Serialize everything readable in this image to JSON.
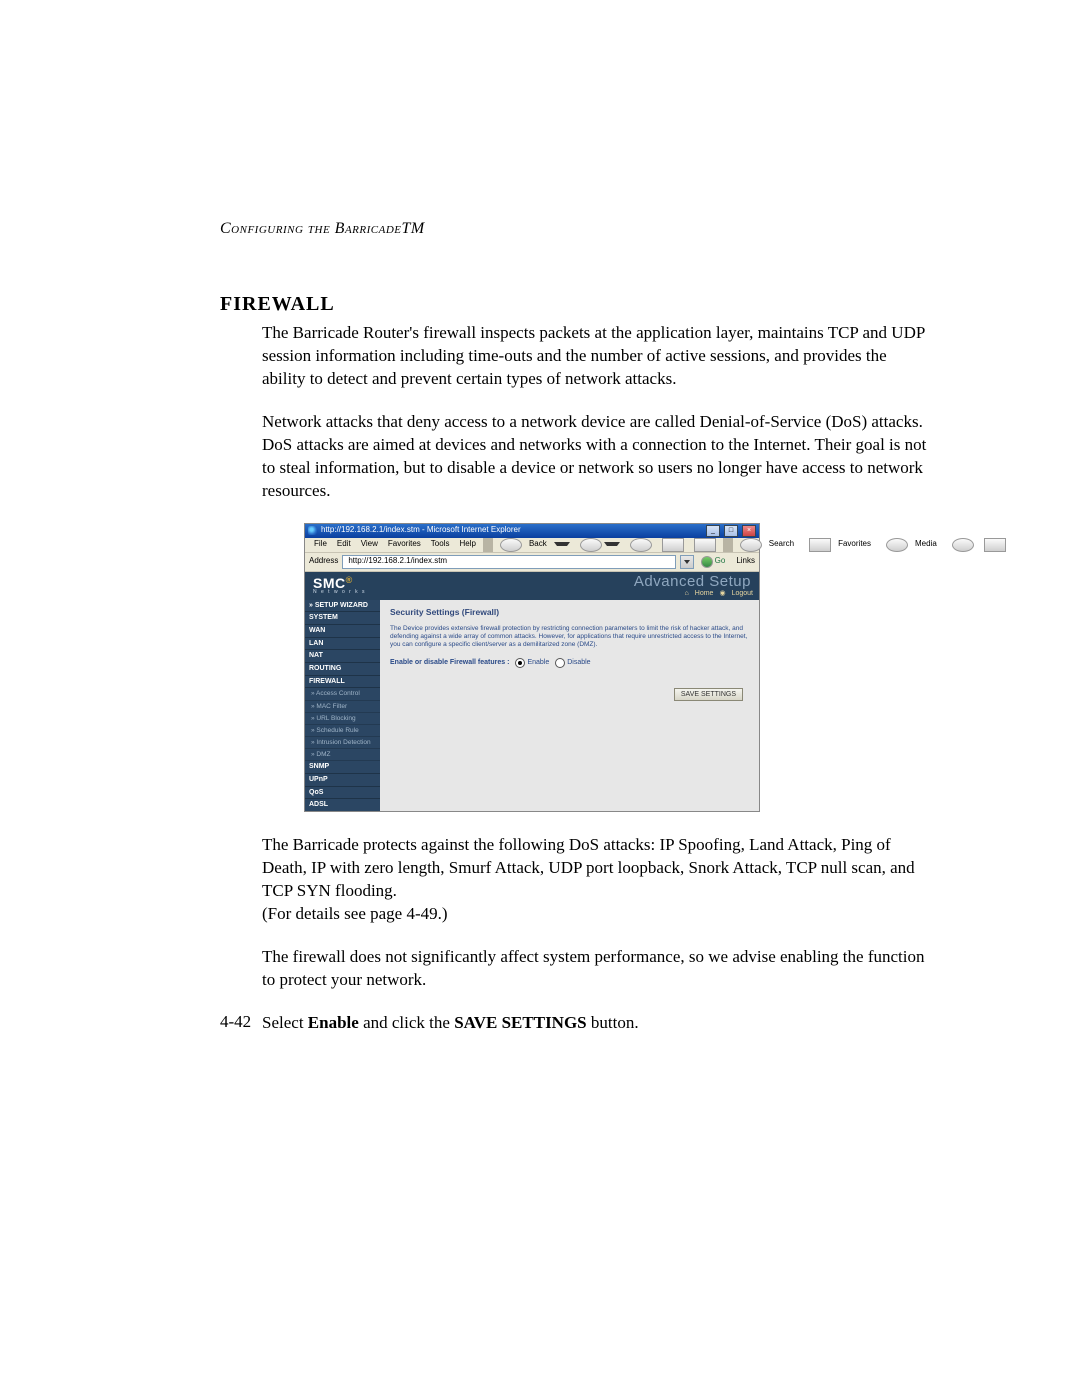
{
  "header": "Configuring the BarricadeTM",
  "section_title": "FIREWALL",
  "para1": "The Barricade Router's firewall inspects packets at the application layer, maintains TCP and UDP session information including time-outs and the number of active sessions, and provides the ability to detect and prevent certain types of network attacks.",
  "para2": "Network attacks that deny access to a network device are called Denial-of-Service (DoS) attacks. DoS attacks are aimed at devices and networks with a connection to the Internet. Their goal is not to steal information, but to disable a device or network so users no longer have access to network resources.",
  "para3a": "The Barricade protects against the following DoS attacks: IP Spoofing, Land Attack, Ping of Death, IP with zero length, Smurf Attack, UDP port loopback, Snork Attack, TCP null scan, and TCP SYN flooding.",
  "para3b": "(For details see page 4-49.)",
  "para4": "The firewall does not significantly affect system performance, so we advise enabling the function to protect your network.",
  "para5_prefix": "Select ",
  "para5_bold1": "Enable",
  "para5_mid": " and click the ",
  "para5_bold2": "SAVE SETTINGS",
  "para5_suffix": " button.",
  "page_num": "4-42",
  "ie": {
    "title": "http://192.168.2.1/index.stm - Microsoft Internet Explorer",
    "menu": {
      "file": "File",
      "edit": "Edit",
      "view": "View",
      "favorites": "Favorites",
      "tools": "Tools",
      "help": "Help"
    },
    "toolbar": {
      "back": "Back",
      "search": "Search",
      "favorites": "Favorites",
      "media": "Media"
    },
    "address_label": "Address",
    "address_value": "http://192.168.2.1/index.stm",
    "go": "Go",
    "links": "Links"
  },
  "router": {
    "brand": "SMC",
    "brand_sub": "N e t w o r k s",
    "advanced": "Advanced Setup",
    "home": "Home",
    "logout": "Logout",
    "nav_setup": "» SETUP WIZARD",
    "nav_items": [
      "SYSTEM",
      "WAN",
      "LAN",
      "NAT",
      "ROUTING",
      "FIREWALL"
    ],
    "nav_subs": [
      "» Access Control",
      "» MAC Filter",
      "» URL Blocking",
      "» Schedule Rule",
      "» Intrusion Detection",
      "» DMZ"
    ],
    "nav_items2": [
      "SNMP",
      "UPnP",
      "QoS",
      "ADSL"
    ],
    "main_title": "Security Settings (Firewall)",
    "main_desc": "The Device provides extensive firewall protection by restricting connection parameters to limit the risk of hacker attack, and defending against a wide array of common attacks. However, for applications that require unrestricted access to the Internet, you can configure a specific client/server as a demilitarized zone (DMZ).",
    "control_label": "Enable or disable Firewall features :",
    "enable": "Enable",
    "disable": "Disable",
    "save": "SAVE SETTINGS"
  }
}
